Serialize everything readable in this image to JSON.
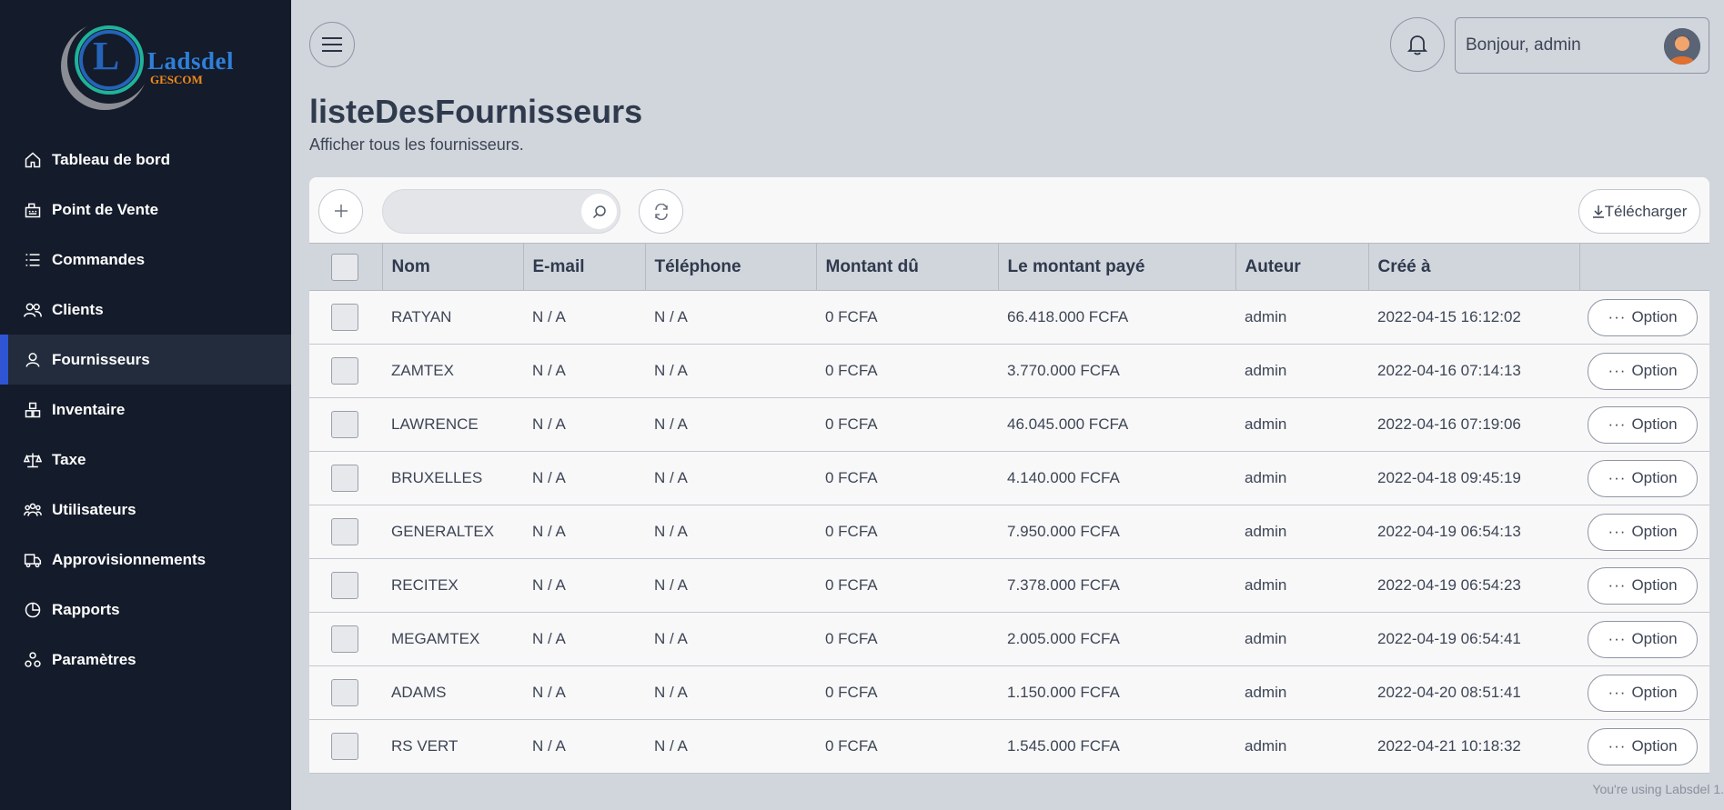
{
  "brand": {
    "name": "Ladsdel",
    "sub": "GESCOM",
    "letter": "L"
  },
  "sidebar": {
    "items": [
      {
        "label": "Tableau de bord",
        "icon": "home-icon"
      },
      {
        "label": "Point de Vente",
        "icon": "pos-icon"
      },
      {
        "label": "Commandes",
        "icon": "list-icon"
      },
      {
        "label": "Clients",
        "icon": "users-icon"
      },
      {
        "label": "Fournisseurs",
        "icon": "user-icon",
        "active": true
      },
      {
        "label": "Inventaire",
        "icon": "boxes-icon"
      },
      {
        "label": "Taxe",
        "icon": "scale-icon"
      },
      {
        "label": "Utilisateurs",
        "icon": "team-icon"
      },
      {
        "label": "Approvisionnements",
        "icon": "truck-icon"
      },
      {
        "label": "Rapports",
        "icon": "pie-chart-icon"
      },
      {
        "label": "Paramètres",
        "icon": "settings-icon"
      }
    ]
  },
  "header": {
    "greeting": "Bonjour, admin"
  },
  "page": {
    "title": "listeDesFournisseurs",
    "subtitle": "Afficher tous les fournisseurs."
  },
  "toolbar": {
    "search_placeholder": "",
    "download_label": "Télécharger"
  },
  "table": {
    "headers": {
      "name": "Nom",
      "email": "E-mail",
      "phone": "Téléphone",
      "due": "Montant dû",
      "paid": "Le montant payé",
      "author": "Auteur",
      "created": "Créé à"
    },
    "option_label": "Option",
    "rows": [
      {
        "name": "RATYAN",
        "email": "N / A",
        "phone": "N / A",
        "due": "0 FCFA",
        "paid": "66.418.000 FCFA",
        "author": "admin",
        "created": "2022-04-15 16:12:02"
      },
      {
        "name": "ZAMTEX",
        "email": "N / A",
        "phone": "N / A",
        "due": "0 FCFA",
        "paid": "3.770.000 FCFA",
        "author": "admin",
        "created": "2022-04-16 07:14:13"
      },
      {
        "name": "LAWRENCE",
        "email": "N / A",
        "phone": "N / A",
        "due": "0 FCFA",
        "paid": "46.045.000 FCFA",
        "author": "admin",
        "created": "2022-04-16 07:19:06"
      },
      {
        "name": "BRUXELLES",
        "email": "N / A",
        "phone": "N / A",
        "due": "0 FCFA",
        "paid": "4.140.000 FCFA",
        "author": "admin",
        "created": "2022-04-18 09:45:19"
      },
      {
        "name": "GENERALTEX",
        "email": "N / A",
        "phone": "N / A",
        "due": "0 FCFA",
        "paid": "7.950.000 FCFA",
        "author": "admin",
        "created": "2022-04-19 06:54:13"
      },
      {
        "name": "RECITEX",
        "email": "N / A",
        "phone": "N / A",
        "due": "0 FCFA",
        "paid": "7.378.000 FCFA",
        "author": "admin",
        "created": "2022-04-19 06:54:23"
      },
      {
        "name": "MEGAMTEX",
        "email": "N / A",
        "phone": "N / A",
        "due": "0 FCFA",
        "paid": "2.005.000 FCFA",
        "author": "admin",
        "created": "2022-04-19 06:54:41"
      },
      {
        "name": "ADAMS",
        "email": "N / A",
        "phone": "N / A",
        "due": "0 FCFA",
        "paid": "1.150.000 FCFA",
        "author": "admin",
        "created": "2022-04-20 08:51:41"
      },
      {
        "name": "RS VERT",
        "email": "N / A",
        "phone": "N / A",
        "due": "0 FCFA",
        "paid": "1.545.000 FCFA",
        "author": "admin",
        "created": "2022-04-21 10:18:32"
      }
    ]
  },
  "footer": {
    "text": "You're using Labsdel 1."
  },
  "colors": {
    "sidebar_bg": "#141b2a",
    "active_accent": "#2f55d4",
    "content_bg": "#d1d5dc",
    "brand_blue": "#2f7fd8",
    "brand_orange": "#f08a1c"
  }
}
